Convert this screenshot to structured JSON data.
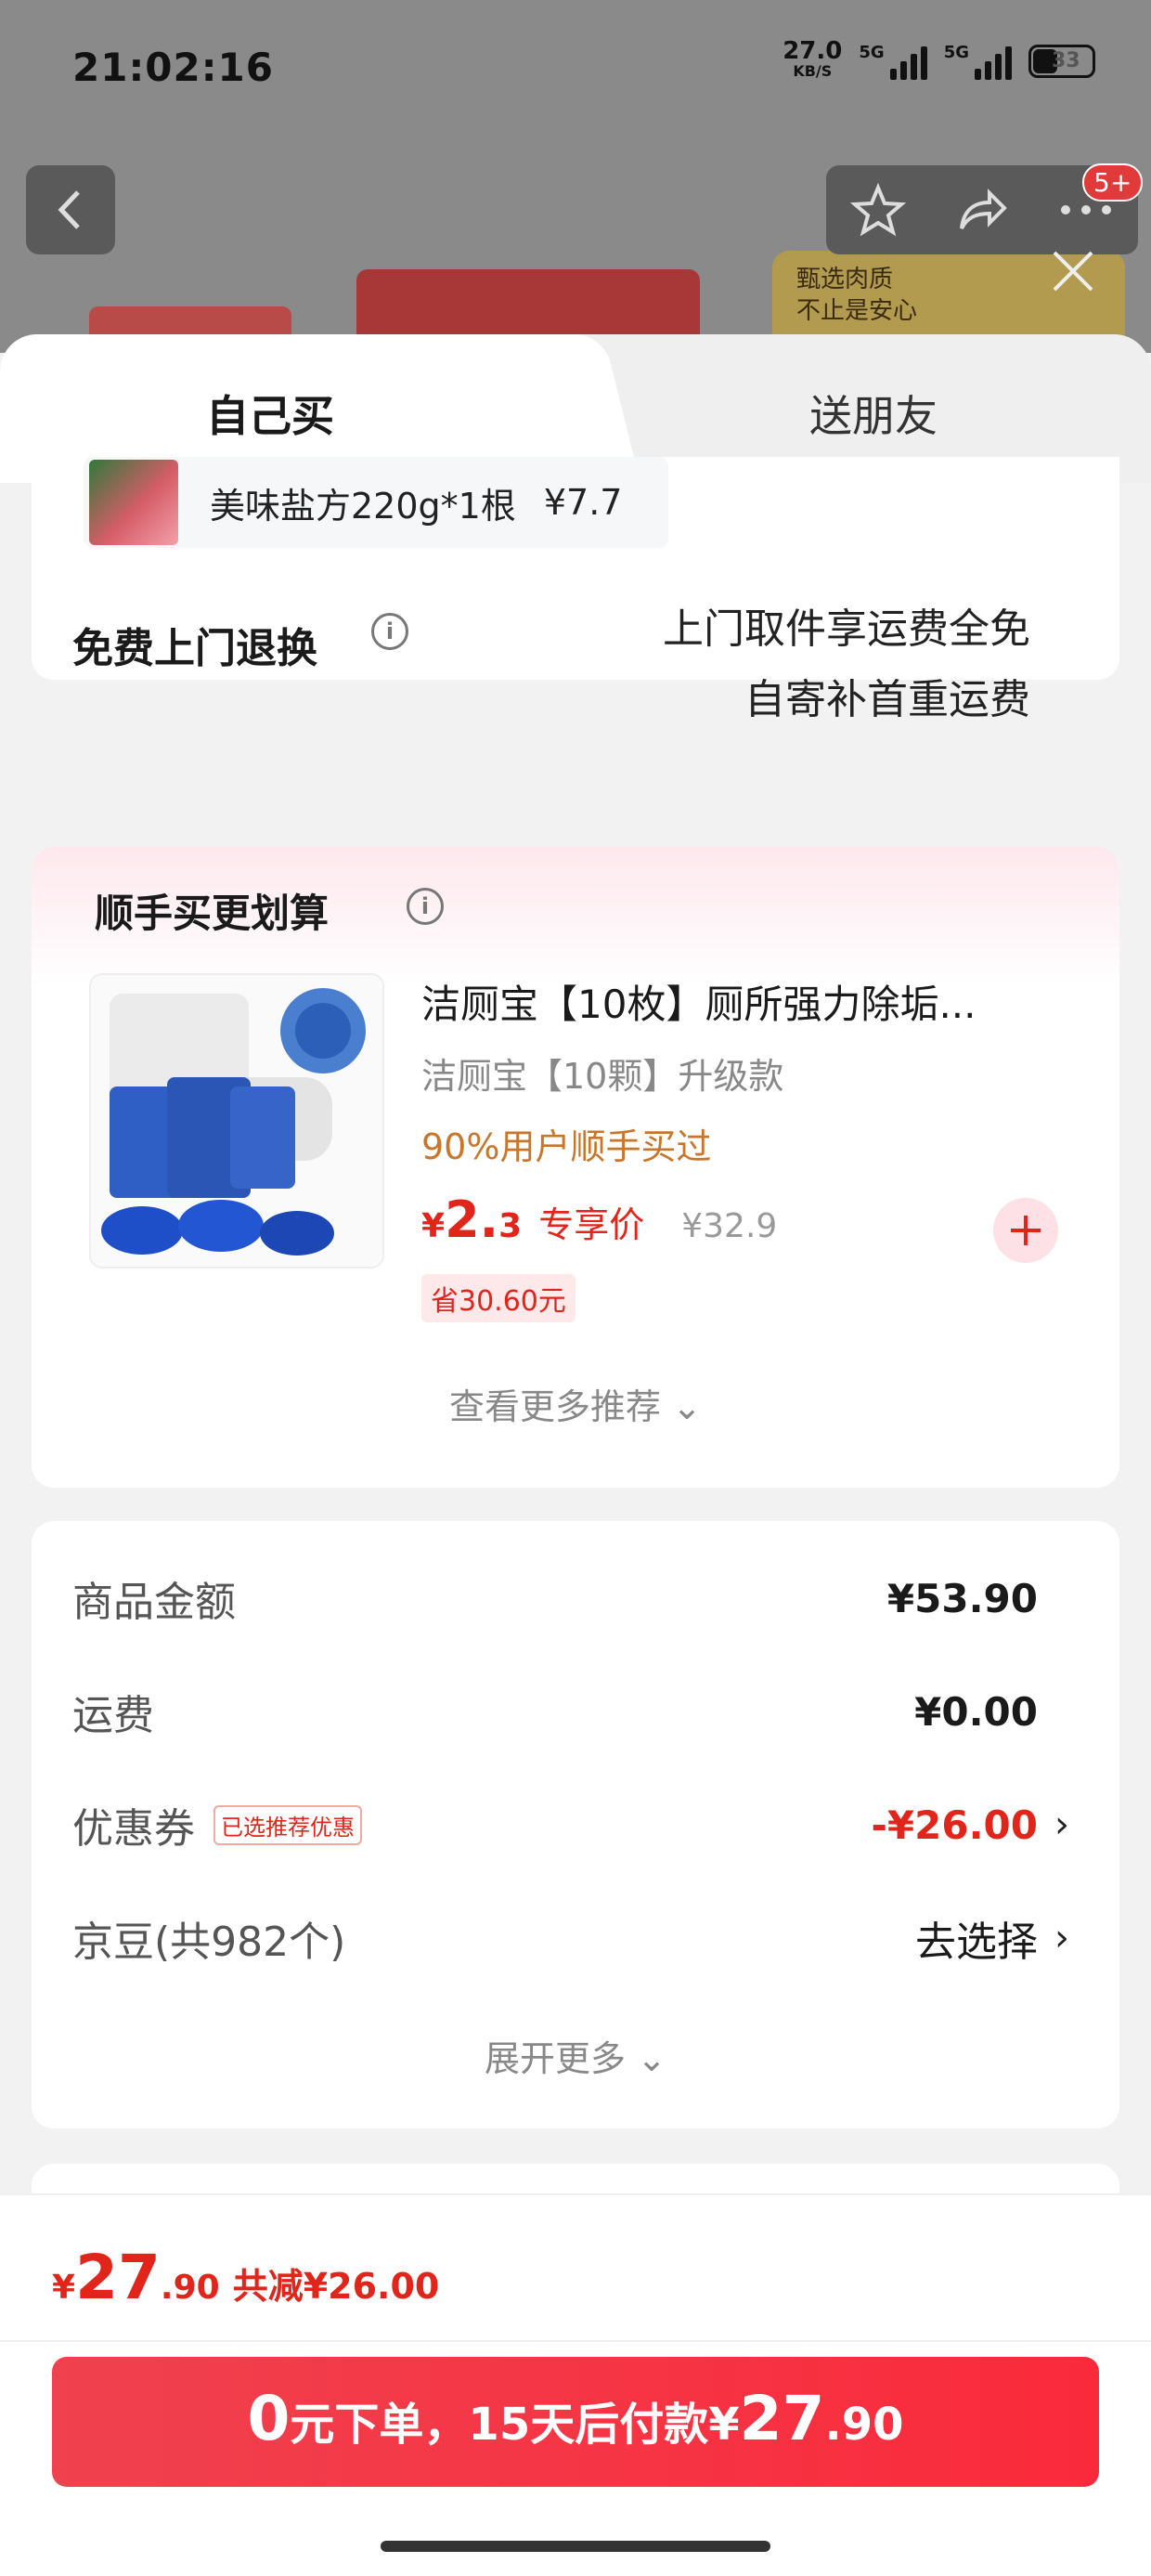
{
  "status_bar": {
    "time": "21:02:16",
    "net_speed": "27.0",
    "net_unit": "KB/S",
    "sig1": "5G",
    "sig2": "5G",
    "battery": "33"
  },
  "background": {
    "badge": "5+",
    "promo_text_line1": "甄选肉质",
    "promo_text_line2": "不止是安心"
  },
  "tabs": [
    {
      "label": "自己买",
      "active": true
    },
    {
      "label": "送朋友",
      "active": false
    }
  ],
  "gift": {
    "name": "美味盐方220g*1根",
    "price": "¥7.7"
  },
  "return_service": {
    "title": "免费上门退换",
    "line1": "上门取件享运费全免",
    "line2": "自寄补首重运费"
  },
  "add_on": {
    "title": "顺手买更划算",
    "product_name": "洁厕宝【10枚】厕所强力除垢...",
    "spec": "洁厕宝【10颗】升级款",
    "buy_hint": "90%用户顺手买过",
    "price_symbol": "¥",
    "price_int": "2.",
    "price_dec": "3",
    "price_tag": "专享价",
    "original_price": "¥32.9",
    "save": "省30.60元",
    "more": "查看更多推荐 ⌄"
  },
  "summary": {
    "goods_label": "商品金额",
    "goods_value": "¥53.90",
    "shipping_label": "运费",
    "shipping_value": "¥0.00",
    "coupon_label": "优惠券",
    "coupon_tag": "已选推荐优惠",
    "coupon_value": "-¥26.00",
    "beans_label": "京豆(共982个)",
    "beans_value": "去选择",
    "expand": "展开更多 ⌄"
  },
  "bottom": {
    "total_symbol": "¥",
    "total_int": "27",
    "total_dec": ".90",
    "total_less": "共减¥26.00",
    "pay_big1": "0",
    "pay_text": "元下单，15天后付款¥",
    "pay_big2": "27",
    "pay_dec": ".90"
  },
  "colors": {
    "accent": "#e1251b",
    "button": "#f52f3f",
    "hint": "#c9762a"
  }
}
